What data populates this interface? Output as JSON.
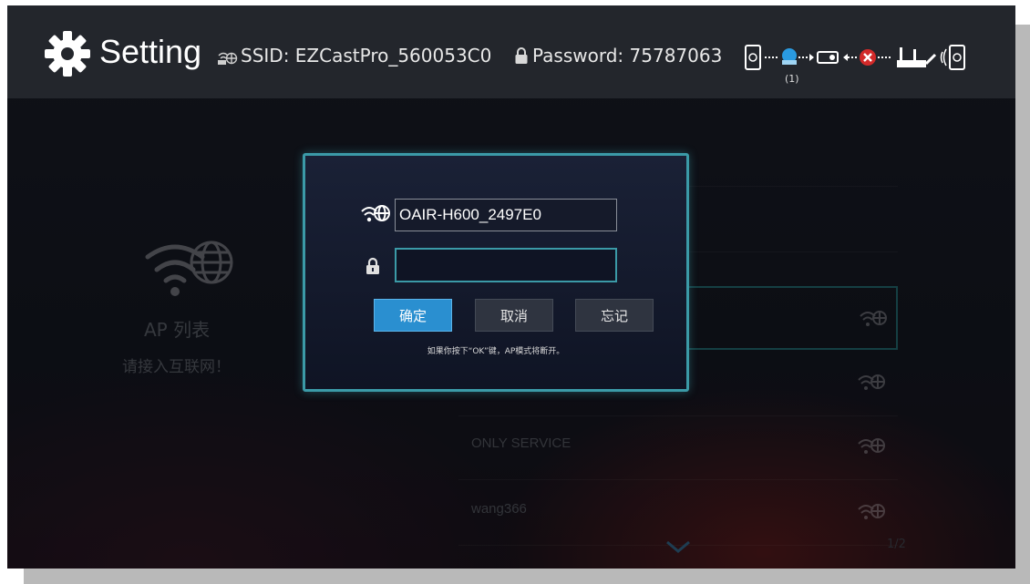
{
  "header": {
    "title": "Setting",
    "ssid_text": "SSID: EZCastPro_560053C0",
    "password_text": "Password: 75787063",
    "connection_count": "(1)"
  },
  "left_panel": {
    "title": "AP 列表",
    "subtitle": "请接入互联网！"
  },
  "ap_list": {
    "items": [
      {
        "name": ""
      },
      {
        "name": ""
      },
      {
        "name": "",
        "selected": true
      },
      {
        "name": ""
      },
      {
        "name": "ONLY SERVICE"
      },
      {
        "name": "wang366"
      }
    ],
    "pager": "1/2"
  },
  "dialog": {
    "ssid_value": "OAIR-H600_2497E0",
    "password_value": "",
    "ok_label": "确定",
    "cancel_label": "取消",
    "forget_label": "忘记",
    "note": "如果你按下“OK”键，AP模式将断开。"
  },
  "colors": {
    "accent": "#3b9aa7",
    "ok_button": "#2a8fd0",
    "error": "#d22a2a"
  },
  "icons": [
    "gear-icon",
    "wifi-globe-icon",
    "lock-icon",
    "phone-icon",
    "projector-icon",
    "router-icon",
    "error-icon",
    "chevron-down-icon"
  ]
}
